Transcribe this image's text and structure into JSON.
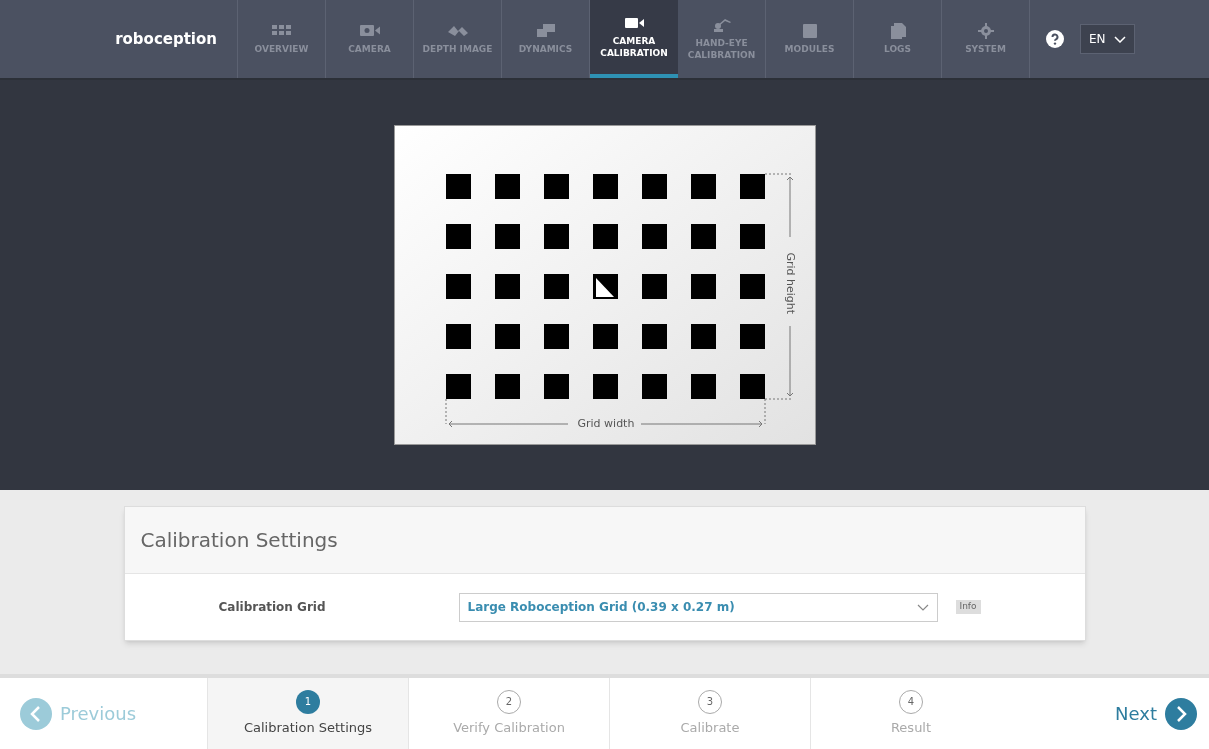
{
  "header": {
    "logo": "roboception",
    "tabs": [
      {
        "label": "OVERVIEW",
        "selected": false
      },
      {
        "label": "CAMERA",
        "selected": false
      },
      {
        "label": "DEPTH IMAGE",
        "selected": false
      },
      {
        "label": "DYNAMICS",
        "selected": false
      },
      {
        "label": "CAMERA CALIBRATION",
        "selected": true
      },
      {
        "label": "HAND-EYE CALIBRATION",
        "selected": false
      },
      {
        "label": "MODULES",
        "selected": false
      },
      {
        "label": "LOGS",
        "selected": false
      },
      {
        "label": "SYSTEM",
        "selected": false
      }
    ],
    "language": "EN"
  },
  "grid_image": {
    "width_label": "Grid width",
    "height_label": "Grid height"
  },
  "settings": {
    "title": "Calibration Settings",
    "fields": [
      {
        "label": "Calibration Grid",
        "value": "Large Roboception Grid (0.39 x 0.27 m)",
        "info": "Info"
      }
    ]
  },
  "footer": {
    "previous": {
      "label": "Previous",
      "disabled": true
    },
    "next": {
      "label": "Next",
      "disabled": false
    },
    "steps": [
      {
        "number": "1",
        "label": "Calibration Settings",
        "selected": true
      },
      {
        "number": "2",
        "label": "Verify Calibration",
        "selected": false
      },
      {
        "number": "3",
        "label": "Calibrate",
        "selected": false
      },
      {
        "number": "4",
        "label": "Result",
        "selected": false
      }
    ]
  }
}
